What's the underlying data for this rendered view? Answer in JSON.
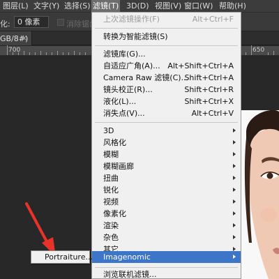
{
  "menubar": {
    "items": [
      "图层(L)",
      "文字(Y)",
      "选择(S)",
      "滤镜(T)",
      "3D(D)",
      "视图(V)",
      "窗口(W)",
      "帮助(H)"
    ],
    "active_index": 3
  },
  "options_bar": {
    "feather_label": "化:",
    "feather_value": "0 像素",
    "antialias_label": "消除锯齿"
  },
  "document_tab": {
    "title": "GB/8#)",
    "close_symbol": "×"
  },
  "ruler": {
    "labels": [
      "700",
      "650"
    ]
  },
  "filter_menu": {
    "items": [
      {
        "label": "上次滤镜操作(F)",
        "shortcut": "Alt+Ctrl+F",
        "disabled": true
      },
      {
        "label": "转换为智能滤镜(S)"
      },
      {
        "label": "滤镜库(G)..."
      },
      {
        "label": "自适应广角(A)...",
        "shortcut": "Alt+Shift+Ctrl+A"
      },
      {
        "label": "Camera Raw 滤镜(C)...",
        "shortcut": "Shift+Ctrl+A"
      },
      {
        "label": "镜头校正(R)...",
        "shortcut": "Shift+Ctrl+R"
      },
      {
        "label": "液化(L)...",
        "shortcut": "Shift+Ctrl+X"
      },
      {
        "label": "消失点(V)...",
        "shortcut": "Alt+Ctrl+V"
      },
      {
        "label": "3D",
        "submenu": true
      },
      {
        "label": "风格化",
        "submenu": true
      },
      {
        "label": "模糊",
        "submenu": true
      },
      {
        "label": "模糊画廊",
        "submenu": true
      },
      {
        "label": "扭曲",
        "submenu": true
      },
      {
        "label": "锐化",
        "submenu": true
      },
      {
        "label": "视频",
        "submenu": true
      },
      {
        "label": "像素化",
        "submenu": true
      },
      {
        "label": "渲染",
        "submenu": true
      },
      {
        "label": "杂色",
        "submenu": true
      },
      {
        "label": "其它",
        "submenu": true
      },
      {
        "label": "Imagenomic",
        "submenu": true,
        "highlighted": true
      },
      {
        "label": "浏览联机滤镜..."
      }
    ]
  },
  "submenu": {
    "items": [
      "Portraiture..."
    ]
  },
  "colors": {
    "menu_highlight": "#3d76c9",
    "annotation_arrow": "#e8332a"
  }
}
